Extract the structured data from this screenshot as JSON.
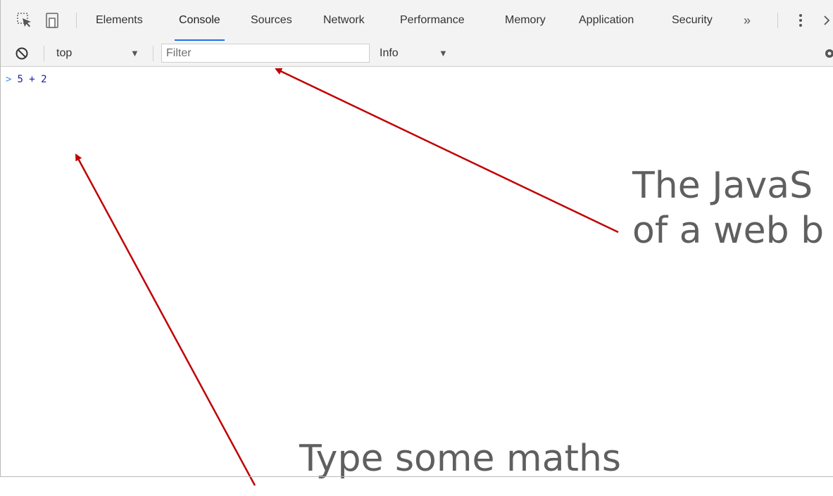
{
  "devtools": {
    "tabs": [
      {
        "label": "Elements",
        "active": false
      },
      {
        "label": "Console",
        "active": true
      },
      {
        "label": "Sources",
        "active": false
      },
      {
        "label": "Network",
        "active": false
      },
      {
        "label": "Performance",
        "active": false
      },
      {
        "label": "Memory",
        "active": false
      },
      {
        "label": "Application",
        "active": false
      },
      {
        "label": "Security",
        "active": false
      }
    ],
    "overflow_label": "»",
    "icons": [
      "inspect-element-icon",
      "device-toolbar-icon",
      "more-options-icon",
      "close-icon"
    ]
  },
  "console_toolbar": {
    "context_label": "top",
    "filter_placeholder": "Filter",
    "level_label": "Info",
    "icons": [
      "clear-console-icon",
      "settings-icon"
    ]
  },
  "console": {
    "input_text": "5 + 2"
  },
  "annotations": {
    "top_text_line1": "The JavaS",
    "top_text_line2": "of a web b",
    "bottom_text_line1": "Type some maths"
  },
  "colors": {
    "accent": "#1a73e8",
    "arrow": "#c00000",
    "annotation_text": "#5f5f5f",
    "prompt": "#1a1aa6"
  }
}
